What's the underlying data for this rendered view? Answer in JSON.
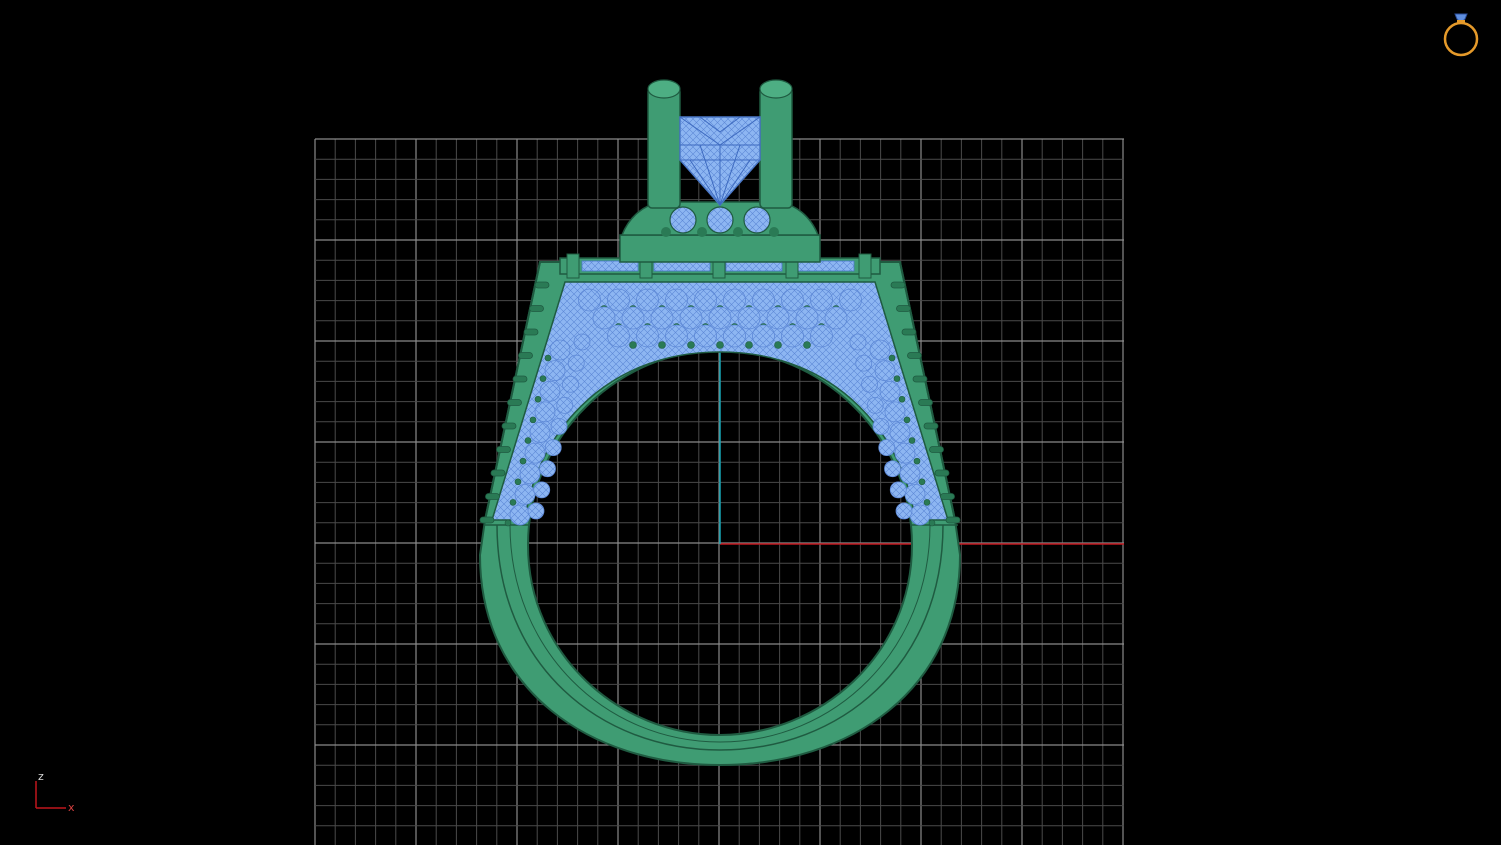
{
  "viewport": {
    "background": "#000000",
    "grid_color": "#7a7a7a",
    "x_axis_color": "#c0151c",
    "z_axis_color": "#17a6b5",
    "metal_color": "#3f9c73",
    "metal_outline": "#1f5b41",
    "gem_color": "#8cb4f0",
    "gem_outline": "#4a78c8"
  },
  "axis_triad": {
    "z_label": "z",
    "x_label": "x"
  },
  "icons": {
    "view_cube": "ring-icon"
  }
}
